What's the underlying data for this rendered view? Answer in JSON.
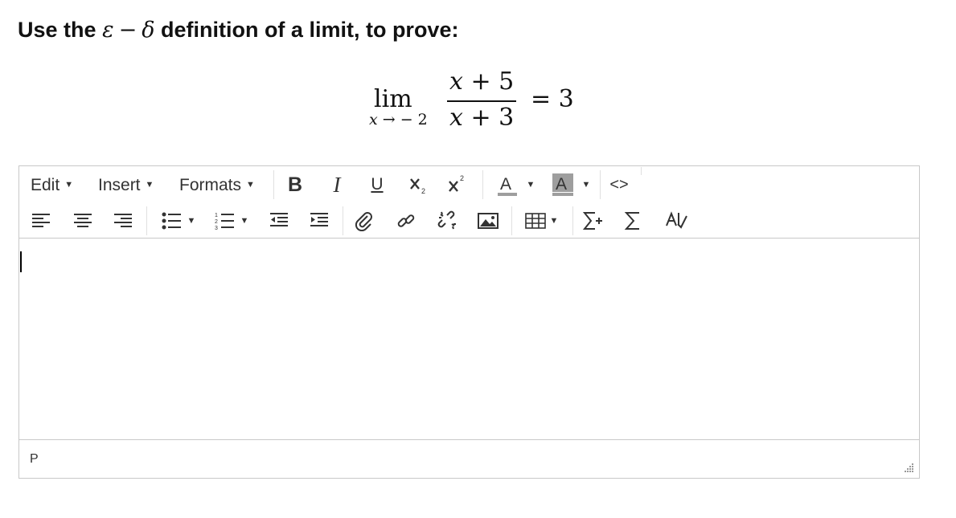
{
  "question": {
    "prefix": "Use the",
    "epsilon": "ε",
    "minus": "−",
    "delta": "δ",
    "suffix": "definition of a limit, to prove:"
  },
  "formula": {
    "lim": "lim",
    "sub_var": "x",
    "sub_rest": " → − 2",
    "num_var": "x",
    "num_rest": " + 5",
    "den_var": "x",
    "den_rest": " + 3",
    "equals": "= 3"
  },
  "toolbar": {
    "menus": {
      "edit": "Edit",
      "insert": "Insert",
      "formats": "Formats"
    },
    "bold": "B",
    "italic": "I",
    "underline": "U",
    "code": "<>"
  },
  "statusbar": {
    "path": "P"
  },
  "icons": [
    "bold-icon",
    "italic-icon",
    "underline-icon",
    "subscript-icon",
    "superscript-icon",
    "text-color-icon",
    "background-color-icon",
    "source-code-icon",
    "align-left-icon",
    "align-center-icon",
    "align-right-icon",
    "bullet-list-icon",
    "numbered-list-icon",
    "outdent-icon",
    "indent-icon",
    "attachment-icon",
    "link-icon",
    "unlink-icon",
    "image-icon",
    "table-icon",
    "equation-insert-icon",
    "sigma-icon",
    "spellcheck-icon",
    "resize-handle-icon"
  ],
  "colors": {
    "border": "#c8c8c8",
    "icon": "#333333",
    "text_color_bar": "#9e9e9e",
    "bg_color_fill": "#9e9e9e"
  }
}
